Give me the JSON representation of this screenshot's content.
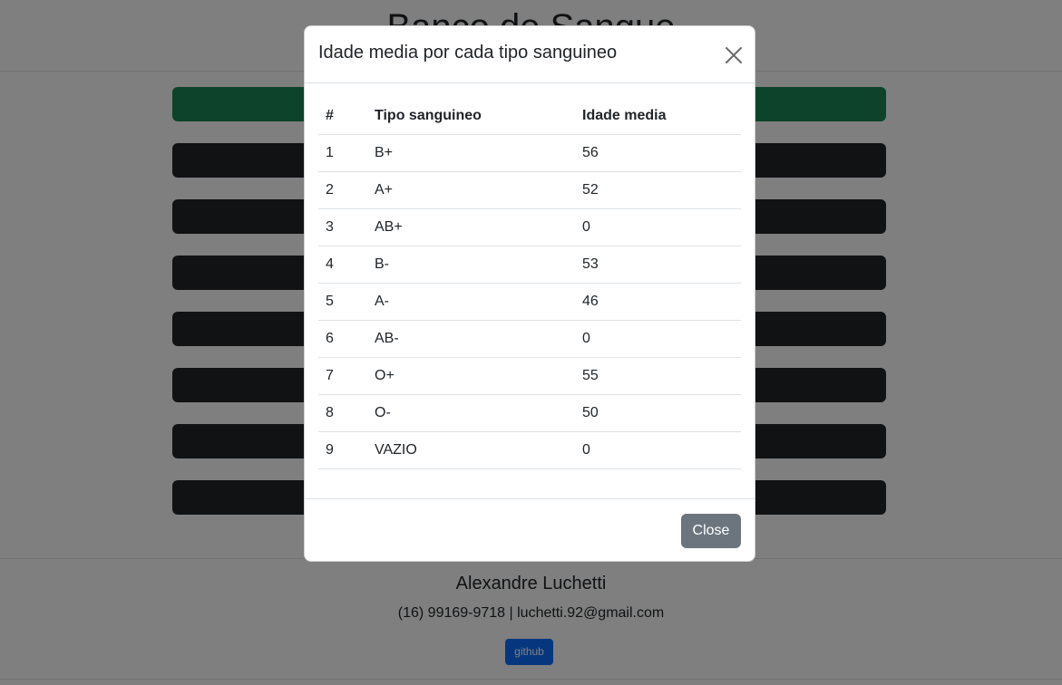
{
  "page": {
    "title": "Banco de Sangue",
    "buttons": [
      {
        "label": "",
        "style": "success"
      },
      {
        "label": "",
        "style": "dark"
      },
      {
        "label": "",
        "style": "dark"
      },
      {
        "label": "",
        "style": "dark"
      },
      {
        "label": "",
        "style": "dark"
      },
      {
        "label": "",
        "style": "dark"
      },
      {
        "label": "",
        "style": "dark"
      },
      {
        "label": "",
        "style": "dark"
      }
    ]
  },
  "footer": {
    "name": "Alexandre Luchetti",
    "contact": "(16) 99169-9718 | luchetti.92@gmail.com",
    "github_label": "github"
  },
  "modal": {
    "title": "Idade media por cada tipo sanguineo",
    "close_icon": "close-icon",
    "table": {
      "headers": [
        "#",
        "Tipo sanguineo",
        "Idade media"
      ],
      "rows": [
        [
          "1",
          "B+",
          "56"
        ],
        [
          "2",
          "A+",
          "52"
        ],
        [
          "3",
          "AB+",
          "0"
        ],
        [
          "4",
          "B-",
          "53"
        ],
        [
          "5",
          "A-",
          "46"
        ],
        [
          "6",
          "AB-",
          "0"
        ],
        [
          "7",
          "O+",
          "55"
        ],
        [
          "8",
          "O-",
          "50"
        ],
        [
          "9",
          "VAZIO",
          "0"
        ]
      ]
    },
    "close_label": "Close"
  },
  "colors": {
    "success": "#198754",
    "dark": "#212529",
    "primary": "#0d6efd",
    "secondary": "#6c757d"
  }
}
